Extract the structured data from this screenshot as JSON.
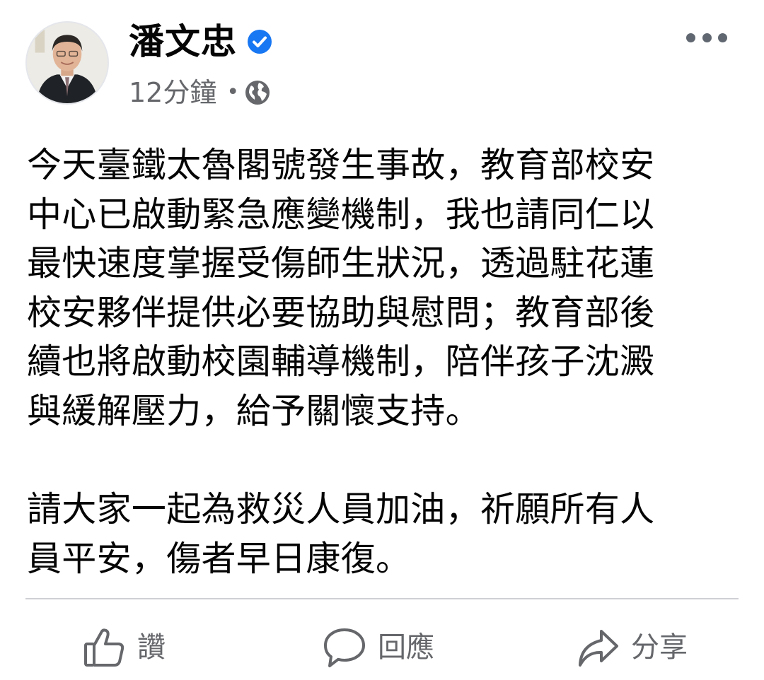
{
  "post": {
    "author": "潘文忠",
    "verified": true,
    "timestamp": "12分鐘",
    "separator": "•",
    "audience_icon": "globe-icon",
    "more_icon": "more-options-icon",
    "paragraphs": [
      "今天臺鐵太魯閣號發生事故，教育部校安\n中心已啟動緊急應變機制，我也請同仁以\n最快速度掌握受傷師生狀況，透過駐花蓮\n校安夥伴提供必要協助與慰問；教育部後\n續也將啟動校園輔導機制，陪伴孩子沈澱\n與緩解壓力，給予關懷支持。",
      "請大家一起為救災人員加油，祈願所有人\n員平安，傷者早日康復。"
    ]
  },
  "actions": {
    "like": {
      "label": "讚",
      "icon": "thumbs-up-icon"
    },
    "comment": {
      "label": "回應",
      "icon": "comment-bubble-icon"
    },
    "share": {
      "label": "分享",
      "icon": "share-arrow-icon"
    }
  },
  "colors": {
    "text": "#050505",
    "secondary_text": "#65676b",
    "verified_badge": "#1877f2",
    "divider": "#ced0d4"
  }
}
